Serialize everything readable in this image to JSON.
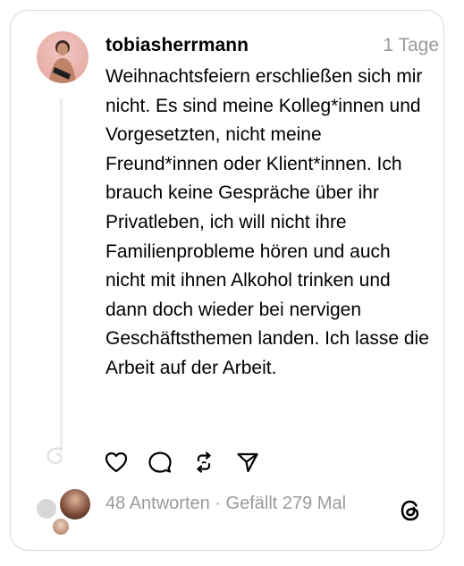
{
  "post": {
    "username": "tobiasherrmann",
    "time": "1 Tage",
    "text": "Weihnachtsfeiern erschließen sich mir nicht. Es sind meine Kolleg*innen und Vorgesetzten, nicht meine Freund*innen oder Klient*innen. Ich brauch keine Gespräche über ihr Privatleben, ich will nicht ihre Familienprobleme hören und auch nicht mit ihnen Alkohol trinken und dann doch wieder bei nervigen Geschäftsthemen landen. Ich lasse die Arbeit auf der Arbeit.",
    "stats": "48 Antworten · Gefällt 279 Mal"
  },
  "icons": {
    "like": "heart-icon",
    "comment": "comment-bubble-icon",
    "repost": "repost-icon",
    "share": "send-icon",
    "brand": "threads-logo-icon"
  }
}
